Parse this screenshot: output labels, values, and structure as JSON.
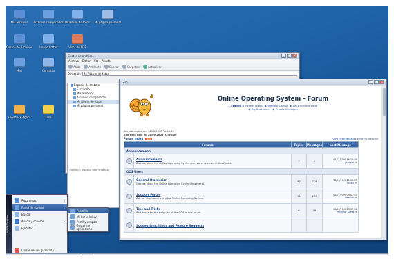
{
  "desktop_icons": [
    {
      "label": "Mis archivos",
      "color": "#5b8fd4"
    },
    {
      "label": "Archivos compartidos",
      "color": "#6aa0e0"
    },
    {
      "label": "Mi álbum de fotos",
      "color": "#7fb0ea"
    },
    {
      "label": "Mi página personal",
      "color": "#9bbde8"
    },
    {
      "label": "Gestor de Archivos",
      "color": "#5b8fd4"
    },
    {
      "label": "Image Editor",
      "color": "#7fb0ea"
    },
    {
      "label": "Visor de PDF",
      "color": "#e27b5a"
    },
    {
      "label": "Mail",
      "color": "#6aa0e0"
    },
    {
      "label": "Contacto",
      "color": "#8fb5e6"
    },
    {
      "label": "Feedback Agent",
      "color": "#f0b24a"
    },
    {
      "label": "Fans",
      "color": "#f3d04a"
    }
  ],
  "file_manager": {
    "title": "Gestor de archivos",
    "menu": [
      "Archivo",
      "Editar",
      "Ver",
      "Ayuda"
    ],
    "toolbar": [
      "Atrás",
      "Adelante",
      "Buscar",
      "Carpetas",
      "Actualizar"
    ],
    "address_label": "Dirección",
    "address_value": "Mi Álbum de fotos",
    "tree": [
      "Espacio de trabajo",
      "Escritorio",
      "Mis archivos",
      "Archivos compartidos",
      "Mi álbum de fotos",
      "Mi página personal"
    ],
    "status": "1 Objeto(s) (Espacio libre en disco)"
  },
  "forum_window": {
    "title": "Foro",
    "heading": "Online Operating System - Forum",
    "links_line1": [
      "Search",
      "Recent Topics",
      "Member Listing",
      "Back to home page"
    ],
    "links_line2": [
      "My Bookmarks",
      "Private Messages"
    ],
    "last_visit": "You last visited on: 14/09/2009 22:56:40",
    "time_now": "The time now is: 14/09/2009 22:56:40",
    "forum_index": "Forum Index",
    "forum_index_tag": "RSS",
    "view_unanswered": "View new messages since my last visit",
    "headers": {
      "forums": "Forums",
      "topics": "Topics",
      "messages": "Messages",
      "last": "Last Message"
    },
    "categories": [
      {
        "name": "Announcements",
        "rows": [
          {
            "name": "Announcements",
            "desc": "Discuss about the Online Operating System news and releases in this forum.",
            "topics": "3",
            "messages": "3",
            "last_date": "01/01/2009 16:28:49",
            "last_user": "jnangen"
          }
        ]
      },
      {
        "name": "OOS Users",
        "rows": [
          {
            "name": "General Discussion",
            "desc": "Discuss about the Online Operating System in general.",
            "topics": "82",
            "messages": "279",
            "last_date": "12/09/2009 21:40:17",
            "last_user": "donkill"
          },
          {
            "name": "Support Forum",
            "desc": "Ask for help about using the Online Operating System.",
            "topics": "54",
            "messages": "139",
            "last_date": "02/07/2009 09:47:51",
            "last_user": "lekenser"
          },
          {
            "name": "Tips and Tricks",
            "desc": "Post tricks for the daily use of the OOS in this forum.",
            "topics": "6",
            "messages": "46",
            "last_date": "06/04/2009 23:35:54",
            "last_user": "Pellevillo_Diego"
          },
          {
            "name": "Suggestions, Ideas and Feature Requests",
            "desc": "",
            "topics": "",
            "messages": "",
            "last_date": "",
            "last_user": ""
          }
        ]
      }
    ]
  },
  "start_menu": {
    "brand": "ICEOS Desktop",
    "items": [
      {
        "label": "Programas",
        "color": "#5b8fd4",
        "arrow": "▸"
      },
      {
        "label": "Panel de control",
        "color": "#6aa0e0",
        "arrow": "▸"
      },
      {
        "label": "Buscar",
        "color": "#8fb5e6",
        "arrow": ""
      },
      {
        "label": "Ayuda y soporte",
        "color": "#3b7ad0",
        "arrow": "▸"
      },
      {
        "label": "Ejecutar...",
        "color": "#9bbde8",
        "arrow": ""
      },
      {
        "label": "Cerrar sesión guardada...",
        "color": "#d9534f",
        "arrow": ""
      }
    ],
    "submenu": [
      "Pantalla",
      "Mi Barra Inicio",
      "Perfil y grupos",
      "Gestor de aplicaciones"
    ]
  },
  "taskbar": {
    "start": "Menú",
    "tasks": [
      "Gestor de archivos",
      "Foro"
    ],
    "clock": "22:57"
  }
}
